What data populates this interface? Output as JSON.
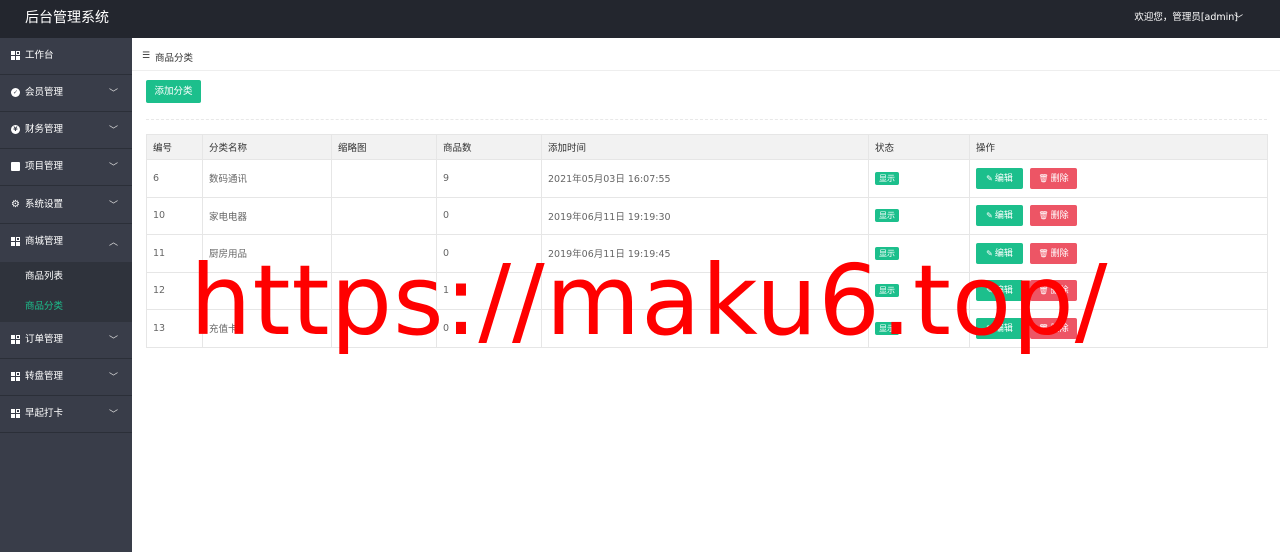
{
  "header": {
    "title": "后台管理系统",
    "user": "欢迎您，管理员[admin]"
  },
  "sidebar": {
    "items": [
      {
        "label": "工作台",
        "icon": "grid-icon"
      },
      {
        "label": "会员管理",
        "icon": "check-circle-icon"
      },
      {
        "label": "财务管理",
        "icon": "yen-circle-icon"
      },
      {
        "label": "项目管理",
        "icon": "document-icon"
      },
      {
        "label": "系统设置",
        "icon": "gear-icon"
      },
      {
        "label": "商城管理",
        "icon": "grid-icon"
      },
      {
        "label": "订单管理",
        "icon": "grid-icon"
      },
      {
        "label": "转盘管理",
        "icon": "grid-icon"
      },
      {
        "label": "早起打卡",
        "icon": "grid-icon"
      }
    ],
    "subitems": [
      {
        "label": "商品列表"
      },
      {
        "label": "商品分类"
      }
    ]
  },
  "breadcrumb": {
    "label": "商品分类"
  },
  "toolbar": {
    "add_label": "添加分类"
  },
  "table": {
    "headers": [
      "编号",
      "分类名称",
      "缩略图",
      "商品数",
      "添加时间",
      "状态",
      "操作"
    ],
    "rows": [
      {
        "id": "6",
        "name": "数码通讯",
        "thumb": "",
        "count": "9",
        "time": "2021年05月03日 16:07:55",
        "status": "显示"
      },
      {
        "id": "10",
        "name": "家电电器",
        "thumb": "",
        "count": "0",
        "time": "2019年06月11日 19:19:30",
        "status": "显示"
      },
      {
        "id": "11",
        "name": "厨房用品",
        "thumb": "",
        "count": "0",
        "time": "2019年06月11日 19:19:45",
        "status": "显示"
      },
      {
        "id": "12",
        "name": "",
        "thumb": "",
        "count": "1",
        "time": "",
        "status": "显示"
      },
      {
        "id": "13",
        "name": "充值卡",
        "thumb": "",
        "count": "0",
        "time": "",
        "status": "显示"
      }
    ],
    "edit_label": "编辑",
    "delete_label": "删除"
  },
  "watermark": "https://maku6.top/",
  "colors": {
    "topbar": "#23262e",
    "sidebar": "#393d49",
    "accent": "#1cbf8c",
    "danger": "#ed5565",
    "watermark": "#ff0000"
  }
}
